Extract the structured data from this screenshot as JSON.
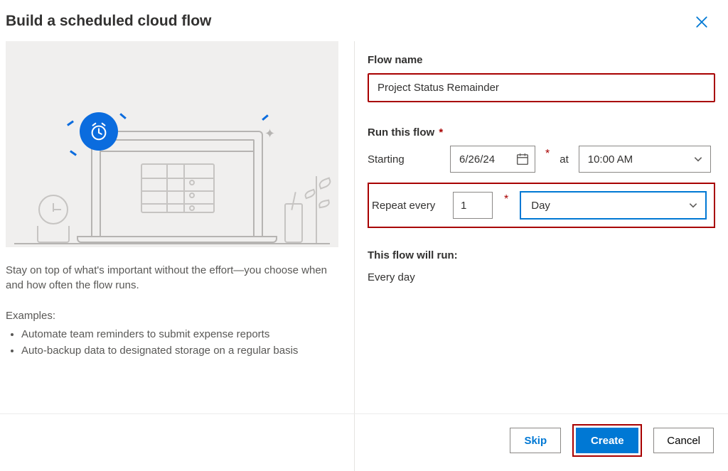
{
  "dialog": {
    "title": "Build a scheduled cloud flow",
    "close_label": "Close"
  },
  "left": {
    "description": "Stay on top of what's important without the effort—you choose when and how often the flow runs.",
    "examples_label": "Examples:",
    "examples": [
      "Automate team reminders to submit expense reports",
      "Auto-backup data to designated storage on a regular basis"
    ]
  },
  "form": {
    "flow_name_label": "Flow name",
    "flow_name_value": "Project Status Remainder",
    "run_label": "Run this flow",
    "starting_label": "Starting",
    "starting_date": "6/26/24",
    "at_label": "at",
    "starting_time": "10:00 AM",
    "repeat_label": "Repeat every",
    "repeat_value": "1",
    "repeat_unit": "Day",
    "summary_label": "This flow will run:",
    "summary_value": "Every day"
  },
  "footer": {
    "skip": "Skip",
    "create": "Create",
    "cancel": "Cancel"
  }
}
